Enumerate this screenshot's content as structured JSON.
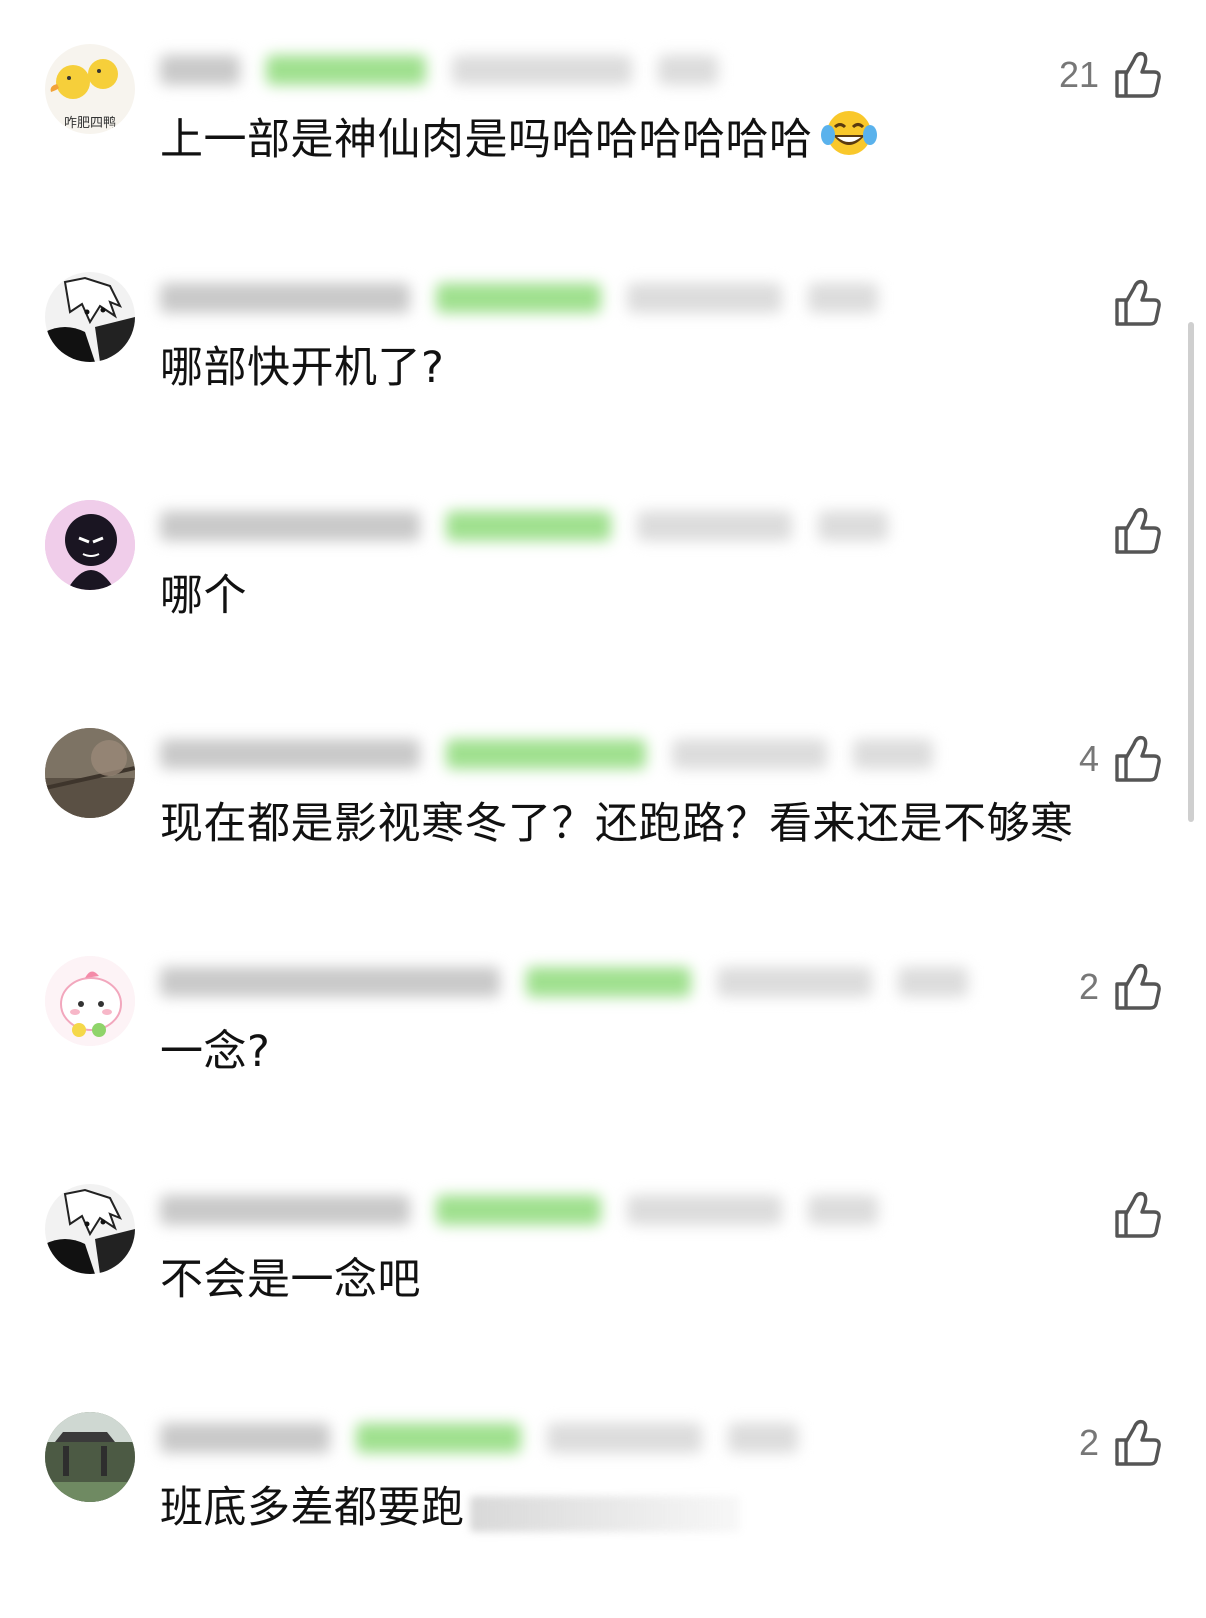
{
  "comments": [
    {
      "avatar_label": "咋肥四鸭",
      "text": "上一部是神仙肉是吗哈哈哈哈哈哈",
      "emoji": "laughing-tears",
      "likes": "21"
    },
    {
      "text": "哪部快开机了?",
      "likes": ""
    },
    {
      "text": "哪个",
      "likes": ""
    },
    {
      "text": "现在都是影视寒冬了？还跑路？看来还是不够寒",
      "likes": "4"
    },
    {
      "text": "一念?",
      "likes": "2"
    },
    {
      "text": "不会是一念吧",
      "likes": ""
    },
    {
      "text": "班底多差都要跑",
      "likes": "2"
    }
  ],
  "colors": {
    "badge": "#9fe08e",
    "text": "#111111",
    "like_count": "#777777",
    "icon": "#555555"
  }
}
